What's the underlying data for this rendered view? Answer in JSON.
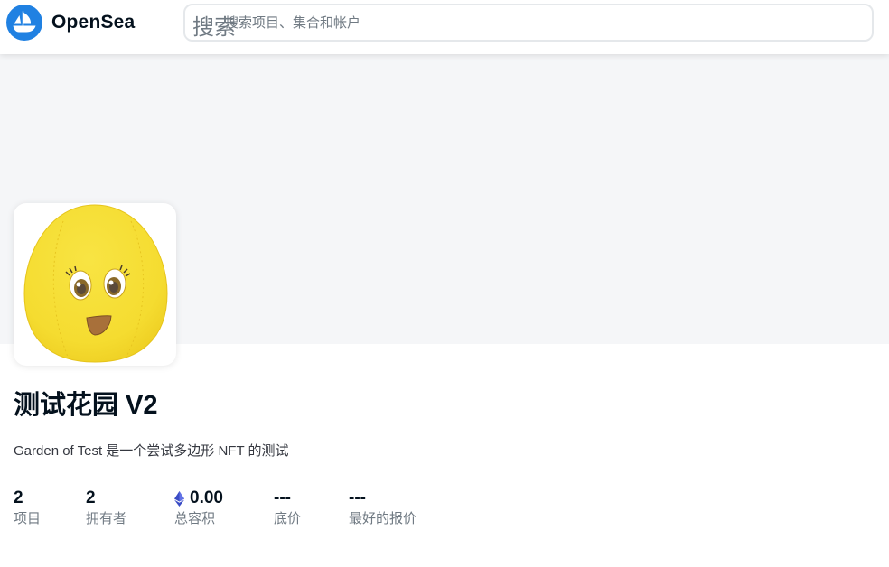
{
  "navbar": {
    "brand": "OpenSea",
    "search": {
      "label": "搜索",
      "placeholder": "搜索项目、集合和帐户"
    }
  },
  "collection": {
    "title": "测试花园 V2",
    "description": "Garden of Test 是一个尝试多边形 NFT 的测试",
    "avatar_icon": "yellow-egg-character-icon"
  },
  "stats": [
    {
      "value": "2",
      "label": "项目"
    },
    {
      "value": "2",
      "label": "拥有者"
    },
    {
      "value": "0.00",
      "label": "总容积",
      "icon": "ethereum-icon"
    },
    {
      "value": "---",
      "label": "底价"
    },
    {
      "value": "---",
      "label": "最好的报价"
    }
  ],
  "colors": {
    "brand_blue": "#2081e2",
    "banner_bg": "#f5f6f8",
    "text_primary": "#04111d",
    "text_secondary": "#707a83",
    "egg_yellow": "#f5dc30"
  }
}
